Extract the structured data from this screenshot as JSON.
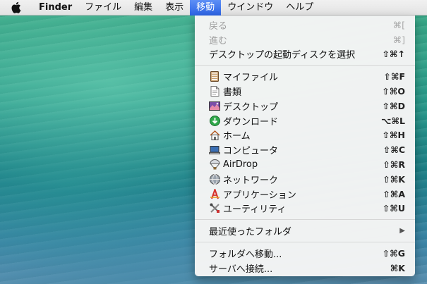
{
  "menubar": {
    "items": [
      {
        "label": "Finder"
      },
      {
        "label": "ファイル"
      },
      {
        "label": "編集"
      },
      {
        "label": "表示"
      },
      {
        "label": "移動"
      },
      {
        "label": "ウインドウ"
      },
      {
        "label": "ヘルプ"
      }
    ]
  },
  "go_menu": {
    "back": {
      "label": "戻る",
      "shortcut": "⌘["
    },
    "forward": {
      "label": "進む",
      "shortcut": "⌘]"
    },
    "startup_disk": {
      "label": "デスクトップの起動ディスクを選択",
      "shortcut": "⇧⌘↑"
    },
    "places": [
      {
        "label": "マイファイル",
        "shortcut": "⇧⌘F",
        "icon": "all-my-files-icon"
      },
      {
        "label": "書類",
        "shortcut": "⇧⌘O",
        "icon": "documents-icon"
      },
      {
        "label": "デスクトップ",
        "shortcut": "⇧⌘D",
        "icon": "desktop-icon"
      },
      {
        "label": "ダウンロード",
        "shortcut": "⌥⌘L",
        "icon": "downloads-icon"
      },
      {
        "label": "ホーム",
        "shortcut": "⇧⌘H",
        "icon": "home-icon"
      },
      {
        "label": "コンピュータ",
        "shortcut": "⇧⌘C",
        "icon": "computer-icon"
      },
      {
        "label": "AirDrop",
        "shortcut": "⇧⌘R",
        "icon": "airdrop-icon"
      },
      {
        "label": "ネットワーク",
        "shortcut": "⇧⌘K",
        "icon": "network-icon"
      },
      {
        "label": "アプリケーション",
        "shortcut": "⇧⌘A",
        "icon": "applications-icon"
      },
      {
        "label": "ユーティリティ",
        "shortcut": "⇧⌘U",
        "icon": "utilities-icon"
      }
    ],
    "recent_folders": {
      "label": "最近使ったフォルダ",
      "submenu_arrow": "▶"
    },
    "go_to_folder": {
      "label": "フォルダへ移動...",
      "shortcut": "⇧⌘G"
    },
    "connect_server": {
      "label": "サーバへ接続...",
      "shortcut": "⌘K"
    }
  },
  "colors": {
    "menu_highlight": "#2b63e4",
    "menu_background": "#f4f4f4"
  }
}
